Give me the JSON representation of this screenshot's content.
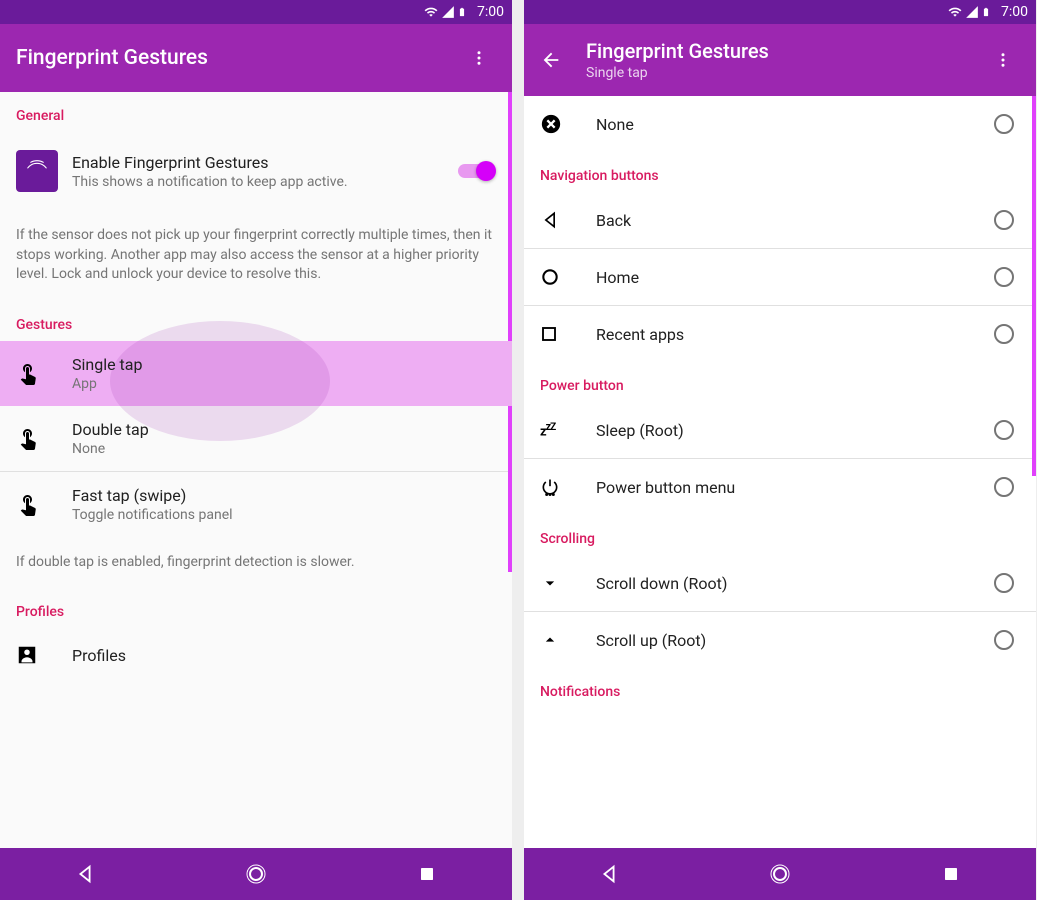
{
  "status": {
    "time": "7:00"
  },
  "left": {
    "title": "Fingerprint Gestures",
    "sections": {
      "general": "General",
      "gestures": "Gestures",
      "profiles": "Profiles"
    },
    "enable": {
      "title": "Enable Fingerprint Gestures",
      "subtitle": "This shows a notification to keep app active."
    },
    "sensor_note": "If the sensor does not pick up your fingerprint correctly multiple times, then it stops working. Another app may also access the sensor at a higher priority level. Lock and unlock your device to resolve this.",
    "gestures": {
      "single": {
        "title": "Single tap",
        "sub": "App"
      },
      "double": {
        "title": "Double tap",
        "sub": "None"
      },
      "fast": {
        "title": "Fast tap (swipe)",
        "sub": "Toggle notifications panel"
      }
    },
    "double_note": "If double tap is enabled, fingerprint detection is slower.",
    "profiles_item": "Profiles"
  },
  "right": {
    "title": "Fingerprint Gestures",
    "subtitle": "Single tap",
    "none": "None",
    "sections": {
      "nav": "Navigation buttons",
      "power": "Power button",
      "scrolling": "Scrolling",
      "notifications": "Notifications"
    },
    "items": {
      "back": "Back",
      "home": "Home",
      "recent": "Recent apps",
      "sleep": "Sleep (Root)",
      "powermenu": "Power button menu",
      "scrolldown": "Scroll down (Root)",
      "scrollup": "Scroll up (Root)"
    }
  }
}
